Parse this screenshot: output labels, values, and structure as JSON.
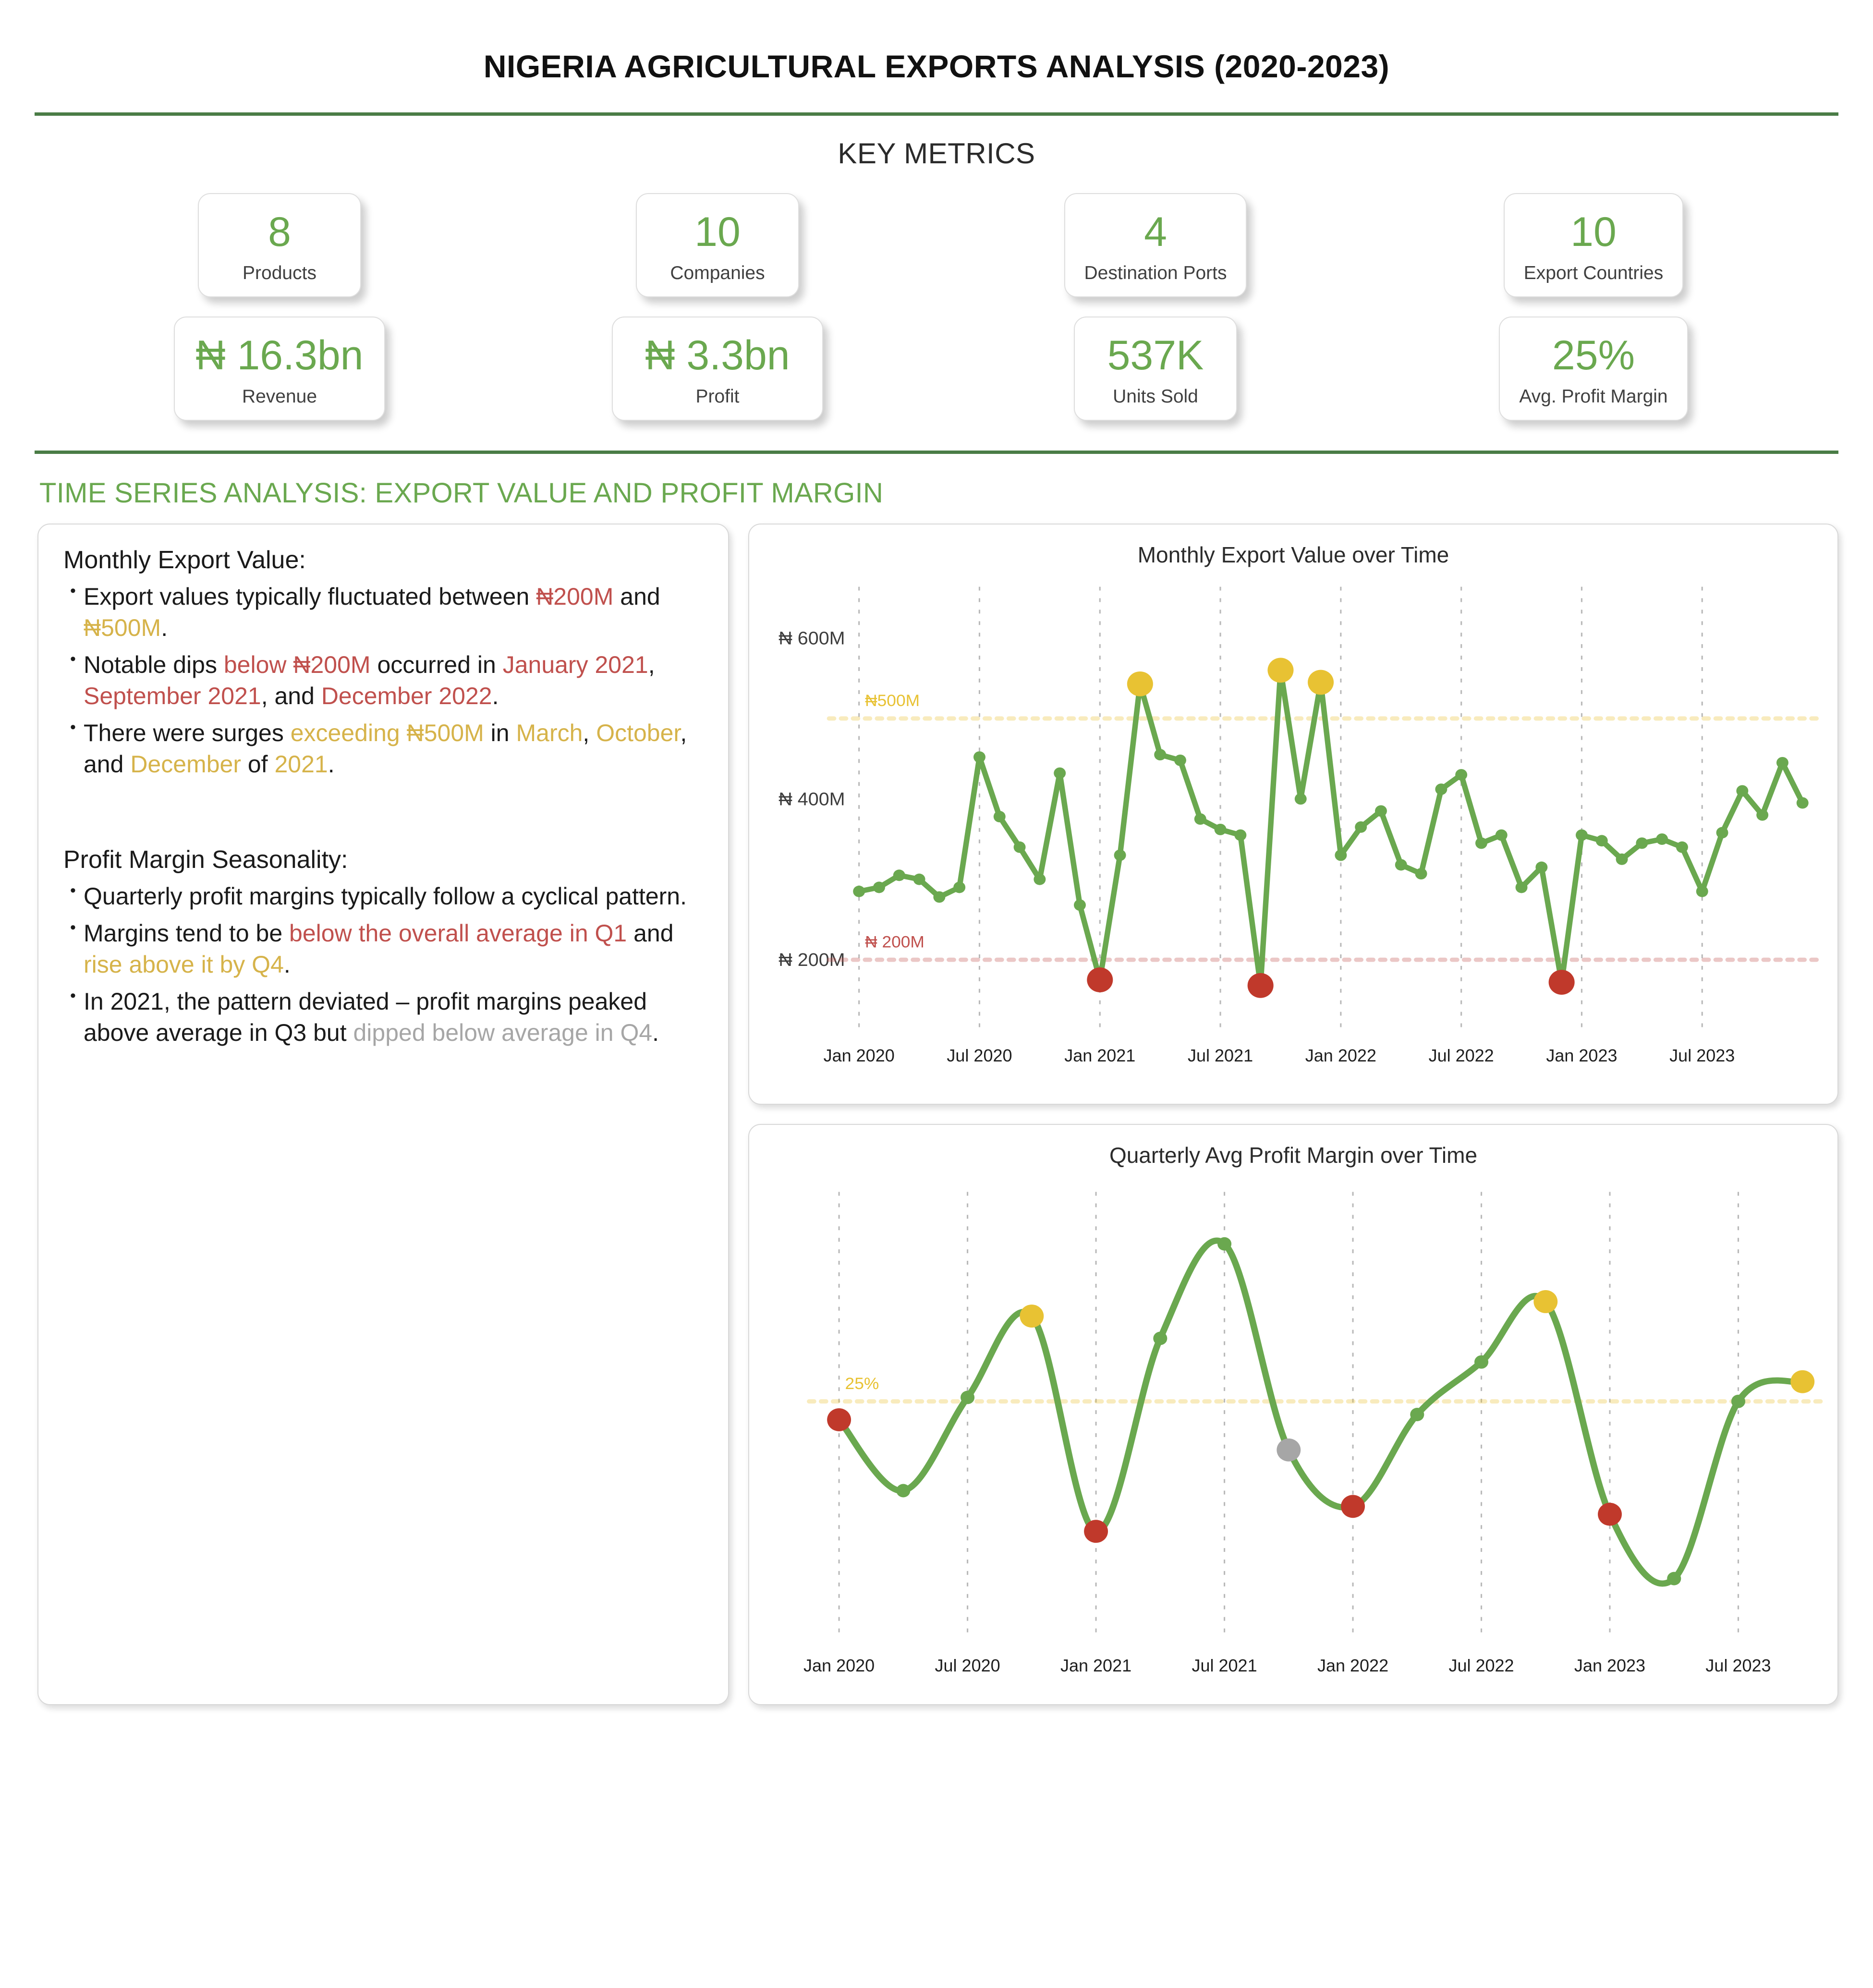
{
  "header": {
    "title": "NIGERIA AGRICULTURAL EXPORTS ANALYSIS (2020-2023)",
    "metrics_title": "KEY METRICS"
  },
  "colors": {
    "green": "#6aa84f",
    "line_green": "#6aa84f",
    "gold": "#e8c233",
    "red": "#c0392b",
    "grey": "#a6a6a6",
    "rule": "#4a7c46",
    "text": "#1a1a1a"
  },
  "kpis": [
    {
      "value": "8",
      "label": "Products"
    },
    {
      "value": "10",
      "label": "Companies"
    },
    {
      "value": "4",
      "label": "Destination Ports"
    },
    {
      "value": "10",
      "label": "Export Countries"
    },
    {
      "value": "₦ 16.3bn",
      "label": "Revenue"
    },
    {
      "value": "₦ 3.3bn",
      "label": "Profit"
    },
    {
      "value": "537K",
      "label": "Units Sold"
    },
    {
      "value": "25%",
      "label": "Avg. Profit Margin"
    }
  ],
  "section": {
    "title": "TIME SERIES ANALYSIS: EXPORT VALUE AND PROFIT MARGIN"
  },
  "insights": {
    "block1_title": "Monthly Export Value:",
    "block1_bullets": [
      [
        {
          "t": "Export values typically fluctuated between ",
          "c": ""
        },
        {
          "t": "₦200M",
          "c": "red"
        },
        {
          "t": " and ",
          "c": ""
        },
        {
          "t": "₦500M",
          "c": "gold"
        },
        {
          "t": ".",
          "c": ""
        }
      ],
      [
        {
          "t": "Notable dips ",
          "c": ""
        },
        {
          "t": "below ₦200M",
          "c": "red"
        },
        {
          "t": " occurred in ",
          "c": ""
        },
        {
          "t": "January 2021",
          "c": "red"
        },
        {
          "t": ", ",
          "c": ""
        },
        {
          "t": "September 2021",
          "c": "red"
        },
        {
          "t": ", and ",
          "c": ""
        },
        {
          "t": "December 2022",
          "c": "red"
        },
        {
          "t": ".",
          "c": ""
        }
      ],
      [
        {
          "t": "There were surges ",
          "c": ""
        },
        {
          "t": "exceeding ₦500M",
          "c": "gold"
        },
        {
          "t": " in ",
          "c": ""
        },
        {
          "t": "March",
          "c": "gold"
        },
        {
          "t": ", ",
          "c": ""
        },
        {
          "t": "October",
          "c": "gold"
        },
        {
          "t": ", and ",
          "c": ""
        },
        {
          "t": "December",
          "c": "gold"
        },
        {
          "t": " of ",
          "c": ""
        },
        {
          "t": "2021",
          "c": "gold"
        },
        {
          "t": ".",
          "c": ""
        }
      ]
    ],
    "block2_title": "Profit Margin Seasonality:",
    "block2_bullets": [
      [
        {
          "t": "Quarterly profit margins typically follow a cyclical pattern.",
          "c": ""
        }
      ],
      [
        {
          "t": "Margins tend to be ",
          "c": ""
        },
        {
          "t": "below the overall average in Q1",
          "c": "red"
        },
        {
          "t": " and ",
          "c": ""
        },
        {
          "t": "rise above it by Q4",
          "c": "gold"
        },
        {
          "t": ".",
          "c": ""
        }
      ],
      [
        {
          "t": "In 2021, the pattern deviated – profit margins peaked above average in Q3 but ",
          "c": ""
        },
        {
          "t": "dipped below average in Q4",
          "c": "grey"
        },
        {
          "t": ".",
          "c": ""
        }
      ]
    ]
  },
  "chart_data": [
    {
      "type": "line",
      "title": "Monthly Export Value over Time",
      "xlabel": "",
      "ylabel": "",
      "ylim": [
        150,
        620
      ],
      "yticks": [
        200,
        400,
        600
      ],
      "ytick_labels": [
        "₦ 200M",
        "₦ 400M",
        "₦ 600M"
      ],
      "grid": true,
      "legend": "none",
      "x_tick_labels": [
        "Jan 2020",
        "Jul 2020",
        "Jan 2021",
        "Jul 2021",
        "Jan 2022",
        "Jul 2022",
        "Jan 2023",
        "Jul 2023"
      ],
      "x_tick_indices": [
        0,
        6,
        12,
        18,
        24,
        30,
        36,
        42
      ],
      "reference_lines": [
        {
          "value": 500,
          "label": "₦500M",
          "color": "#e8c233"
        },
        {
          "value": 200,
          "label": "₦ 200M",
          "color": "#c0504d"
        }
      ],
      "x": [
        "2020-01",
        "2020-02",
        "2020-03",
        "2020-04",
        "2020-05",
        "2020-06",
        "2020-07",
        "2020-08",
        "2020-09",
        "2020-10",
        "2020-11",
        "2020-12",
        "2021-01",
        "2021-02",
        "2021-03",
        "2021-04",
        "2021-05",
        "2021-06",
        "2021-07",
        "2021-08",
        "2021-09",
        "2021-10",
        "2021-11",
        "2021-12",
        "2022-01",
        "2022-02",
        "2022-03",
        "2022-04",
        "2022-05",
        "2022-06",
        "2022-07",
        "2022-08",
        "2022-09",
        "2022-10",
        "2022-11",
        "2022-12",
        "2023-01",
        "2023-02",
        "2023-03",
        "2023-04",
        "2023-05",
        "2023-06",
        "2023-07",
        "2023-08",
        "2023-09",
        "2023-10",
        "2023-11",
        "2023-12"
      ],
      "values": [
        285,
        290,
        305,
        300,
        278,
        290,
        452,
        378,
        340,
        300,
        432,
        268,
        175,
        330,
        543,
        455,
        448,
        375,
        362,
        355,
        168,
        560,
        400,
        545,
        330,
        365,
        385,
        318,
        307,
        412,
        430,
        345,
        355,
        290,
        315,
        172,
        355,
        348,
        325,
        345,
        350,
        340,
        285,
        358,
        410,
        380,
        445,
        395
      ],
      "highlight_high": [
        {
          "x": "2021-03",
          "value": 543,
          "color": "#e8c233"
        },
        {
          "x": "2021-10",
          "value": 560,
          "color": "#e8c233"
        },
        {
          "x": "2021-12",
          "value": 545,
          "color": "#e8c233"
        }
      ],
      "highlight_low": [
        {
          "x": "2021-01",
          "value": 175,
          "color": "#c0392b"
        },
        {
          "x": "2021-09",
          "value": 168,
          "color": "#c0392b"
        },
        {
          "x": "2022-12",
          "value": 172,
          "color": "#c0392b"
        }
      ]
    },
    {
      "type": "line",
      "title": "Quarterly Avg Profit Margin over Time",
      "xlabel": "",
      "ylabel": "",
      "grid": true,
      "legend": "none",
      "x_tick_labels": [
        "Jan 2020",
        "Jul 2020",
        "Jan 2021",
        "Jul 2021",
        "Jan 2022",
        "Jul 2022",
        "Jan 2023",
        "Jul 2023"
      ],
      "reference_lines": [
        {
          "value": 25,
          "label": "25%",
          "color": "#e8c233"
        }
      ],
      "x": [
        "2020-Q1",
        "2020-Q2",
        "2020-Q3",
        "2020-Q4",
        "2021-Q1",
        "2021-Q2",
        "2021-Q3",
        "2021-Q4",
        "2022-Q1",
        "2022-Q2",
        "2022-Q3",
        "2022-Q4",
        "2023-Q1",
        "2023-Q2",
        "2023-Q3",
        "2023-Q4"
      ],
      "values": [
        23.6,
        18.2,
        25.3,
        31.5,
        15.1,
        29.8,
        37.0,
        21.3,
        17.0,
        24.0,
        28.0,
        32.6,
        16.4,
        11.5,
        25.0,
        26.5
      ],
      "markers": [
        {
          "x": "2020-Q1",
          "color": "#c0392b"
        },
        {
          "x": "2020-Q2",
          "color": "#6aa84f"
        },
        {
          "x": "2020-Q3",
          "color": "#6aa84f"
        },
        {
          "x": "2020-Q4",
          "color": "#e8c233"
        },
        {
          "x": "2021-Q1",
          "color": "#c0392b"
        },
        {
          "x": "2021-Q2",
          "color": "#6aa84f"
        },
        {
          "x": "2021-Q3",
          "color": "#6aa84f"
        },
        {
          "x": "2021-Q4",
          "color": "#a6a6a6"
        },
        {
          "x": "2022-Q1",
          "color": "#c0392b"
        },
        {
          "x": "2022-Q2",
          "color": "#6aa84f"
        },
        {
          "x": "2022-Q3",
          "color": "#6aa84f"
        },
        {
          "x": "2022-Q4",
          "color": "#e8c233"
        },
        {
          "x": "2023-Q1",
          "color": "#c0392b"
        },
        {
          "x": "2023-Q2",
          "color": "#6aa84f"
        },
        {
          "x": "2023-Q3",
          "color": "#6aa84f"
        },
        {
          "x": "2023-Q4",
          "color": "#e8c233"
        }
      ]
    }
  ]
}
